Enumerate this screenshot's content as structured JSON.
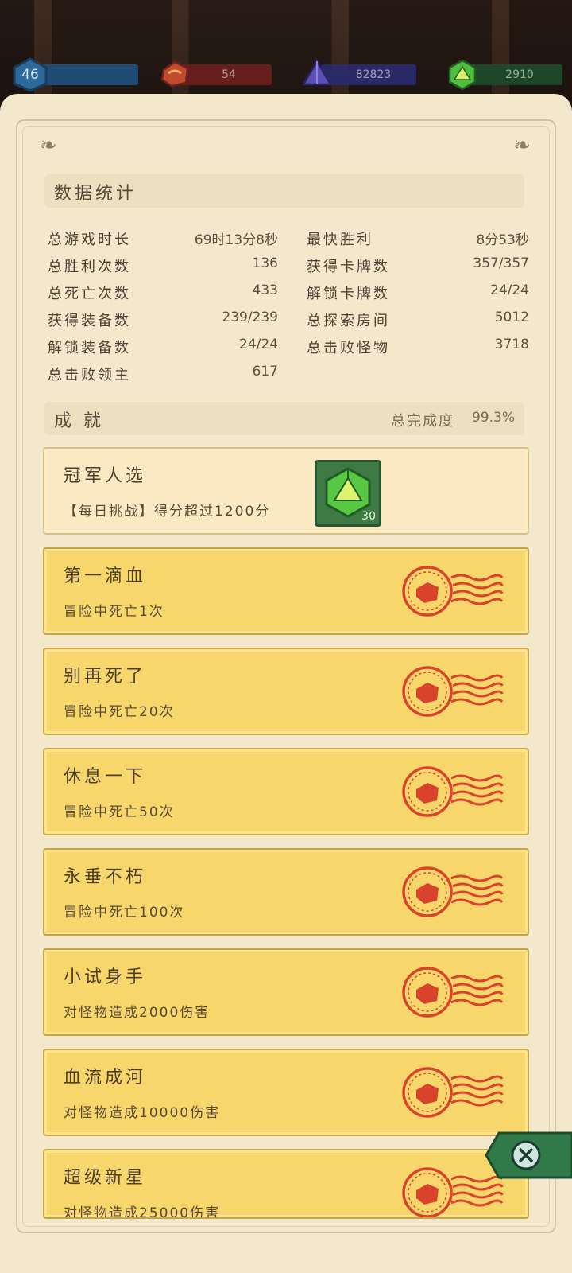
{
  "resources": {
    "level": "46",
    "red_gem": "54",
    "purple_gem": "82823",
    "green_gem": "2910"
  },
  "stats": {
    "title": "数据统计",
    "left": [
      {
        "label": "总游戏时长",
        "value": "69时13分8秒"
      },
      {
        "label": "总胜利次数",
        "value": "136"
      },
      {
        "label": "总死亡次数",
        "value": "433"
      },
      {
        "label": "获得装备数",
        "value": "239/239"
      },
      {
        "label": "解锁装备数",
        "value": "24/24"
      },
      {
        "label": "总击败领主",
        "value": "617"
      }
    ],
    "right": [
      {
        "label": "最快胜利",
        "value": "8分53秒"
      },
      {
        "label": "获得卡牌数",
        "value": "357/357"
      },
      {
        "label": "解锁卡牌数",
        "value": "24/24"
      },
      {
        "label": "总探索房间",
        "value": "5012"
      },
      {
        "label": "总击败怪物",
        "value": "3718"
      }
    ]
  },
  "achievements_header": {
    "title": "成 就",
    "completion_label": "总完成度",
    "completion_value": "99.3%"
  },
  "achievements": [
    {
      "name": "冠军人选",
      "desc": "【每日挑战】得分超过1200分",
      "reward_count": "30",
      "completed": false
    },
    {
      "name": "第一滴血",
      "desc": "冒险中死亡1次",
      "completed": true
    },
    {
      "name": "别再死了",
      "desc": "冒险中死亡20次",
      "completed": true
    },
    {
      "name": "休息一下",
      "desc": "冒险中死亡50次",
      "completed": true
    },
    {
      "name": "永垂不朽",
      "desc": "冒险中死亡100次",
      "completed": true
    },
    {
      "name": "小试身手",
      "desc": "对怪物造成2000伤害",
      "completed": true
    },
    {
      "name": "血流成河",
      "desc": "对怪物造成10000伤害",
      "completed": true
    },
    {
      "name": "超级新星",
      "desc": "对怪物造成25000伤害",
      "completed": true
    }
  ],
  "colors": {
    "paper": "#f3e8cc",
    "card_completed": "#f7d66b",
    "card_pending": "#fbe9c4",
    "stamp_red": "#d9432b",
    "close_green": "#2f7a48"
  },
  "icons": {
    "level": "hexagon-level-icon",
    "red_gem": "red-gem-icon",
    "purple_gem": "purple-crystal-icon",
    "green_gem": "green-d20-gem-icon",
    "stamp": "red-completed-stamp-icon",
    "close": "close-icon"
  }
}
